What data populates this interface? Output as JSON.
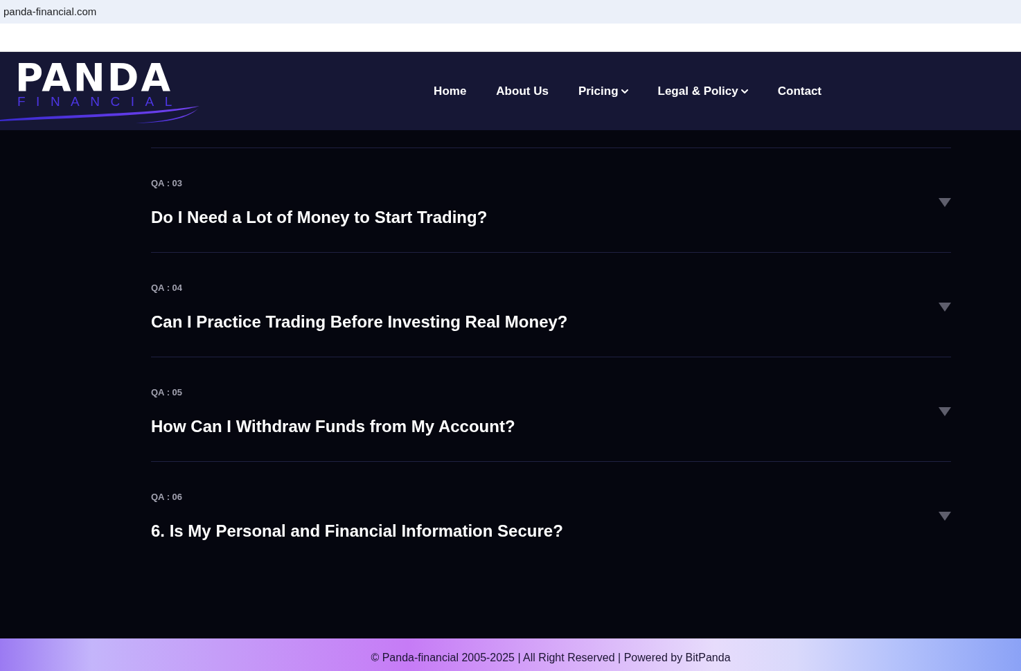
{
  "address_bar": {
    "url": "panda-financial.com"
  },
  "header": {
    "logo": {
      "name": "PANDA",
      "tagline": "FINANCIAL"
    },
    "nav": [
      {
        "label": "Home",
        "dropdown": false
      },
      {
        "label": "About Us",
        "dropdown": false
      },
      {
        "label": "Pricing",
        "dropdown": true
      },
      {
        "label": "Legal & Policy",
        "dropdown": true
      },
      {
        "label": "Contact",
        "dropdown": false
      }
    ]
  },
  "faq": {
    "items": [
      {
        "label": "QA : 03",
        "question": "Do I Need a Lot of Money to Start Trading?",
        "expanded": false
      },
      {
        "label": "QA : 04",
        "question": "Can I Practice Trading Before Investing Real Money?",
        "expanded": false
      },
      {
        "label": "QA : 05",
        "question": "How Can I Withdraw Funds from My Account?",
        "expanded": false
      },
      {
        "label": "QA : 06",
        "question": "6. Is My Personal and Financial Information Secure?",
        "expanded": false
      }
    ]
  },
  "footer": {
    "text": "© Panda-financial 2005-2025 | All Right Reserved | Powered by BitPanda"
  }
}
